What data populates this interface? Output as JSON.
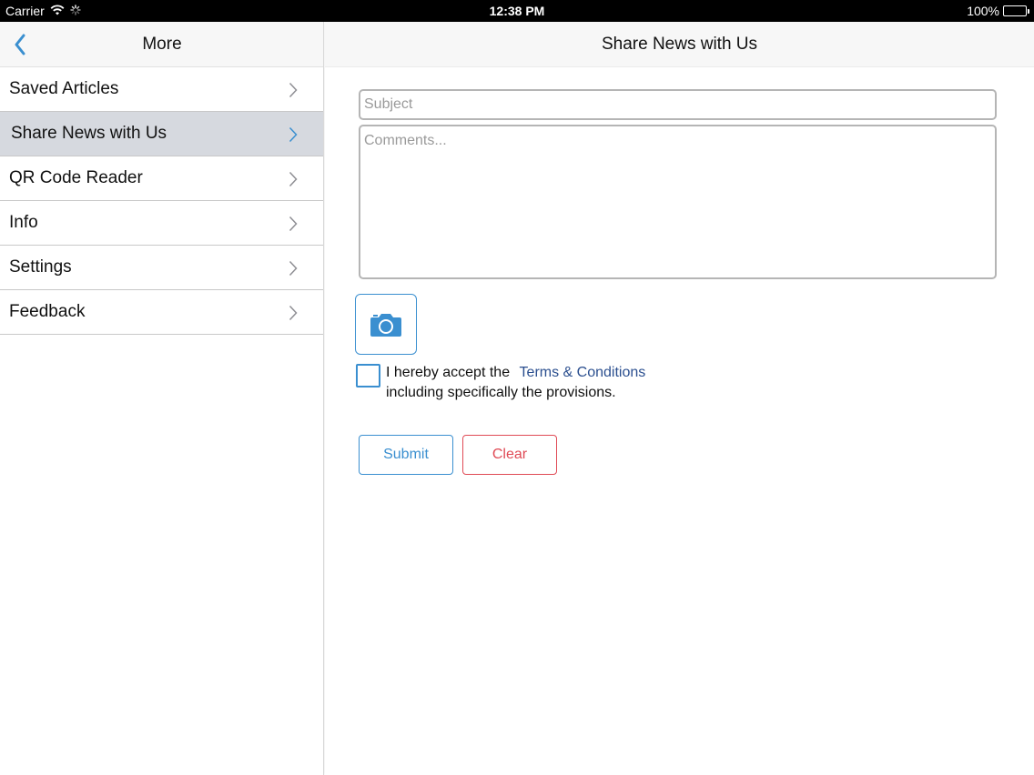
{
  "status_bar": {
    "carrier": "Carrier",
    "time": "12:38 PM",
    "battery": "100%"
  },
  "master": {
    "title": "More",
    "items": [
      {
        "label": "Saved Articles",
        "selected": false
      },
      {
        "label": "Share News with Us",
        "selected": true
      },
      {
        "label": "QR Code Reader",
        "selected": false
      },
      {
        "label": "Info",
        "selected": false
      },
      {
        "label": "Settings",
        "selected": false
      },
      {
        "label": "Feedback",
        "selected": false
      }
    ]
  },
  "detail": {
    "title": "Share News with Us",
    "subject": {
      "value": "",
      "placeholder": "Subject"
    },
    "comments": {
      "value": "",
      "placeholder": "Comments..."
    },
    "camera_icon": "camera-icon",
    "terms": {
      "prefix": "I hereby accept the",
      "link": "Terms & Conditions",
      "suffix": "including specifically the provisions.",
      "checked": false
    },
    "submit_label": "Submit",
    "clear_label": "Clear"
  },
  "colors": {
    "accent": "#3a8fd0",
    "link": "#2b4f8f",
    "danger": "#e04a55",
    "selected_row": "#d6d9df"
  }
}
